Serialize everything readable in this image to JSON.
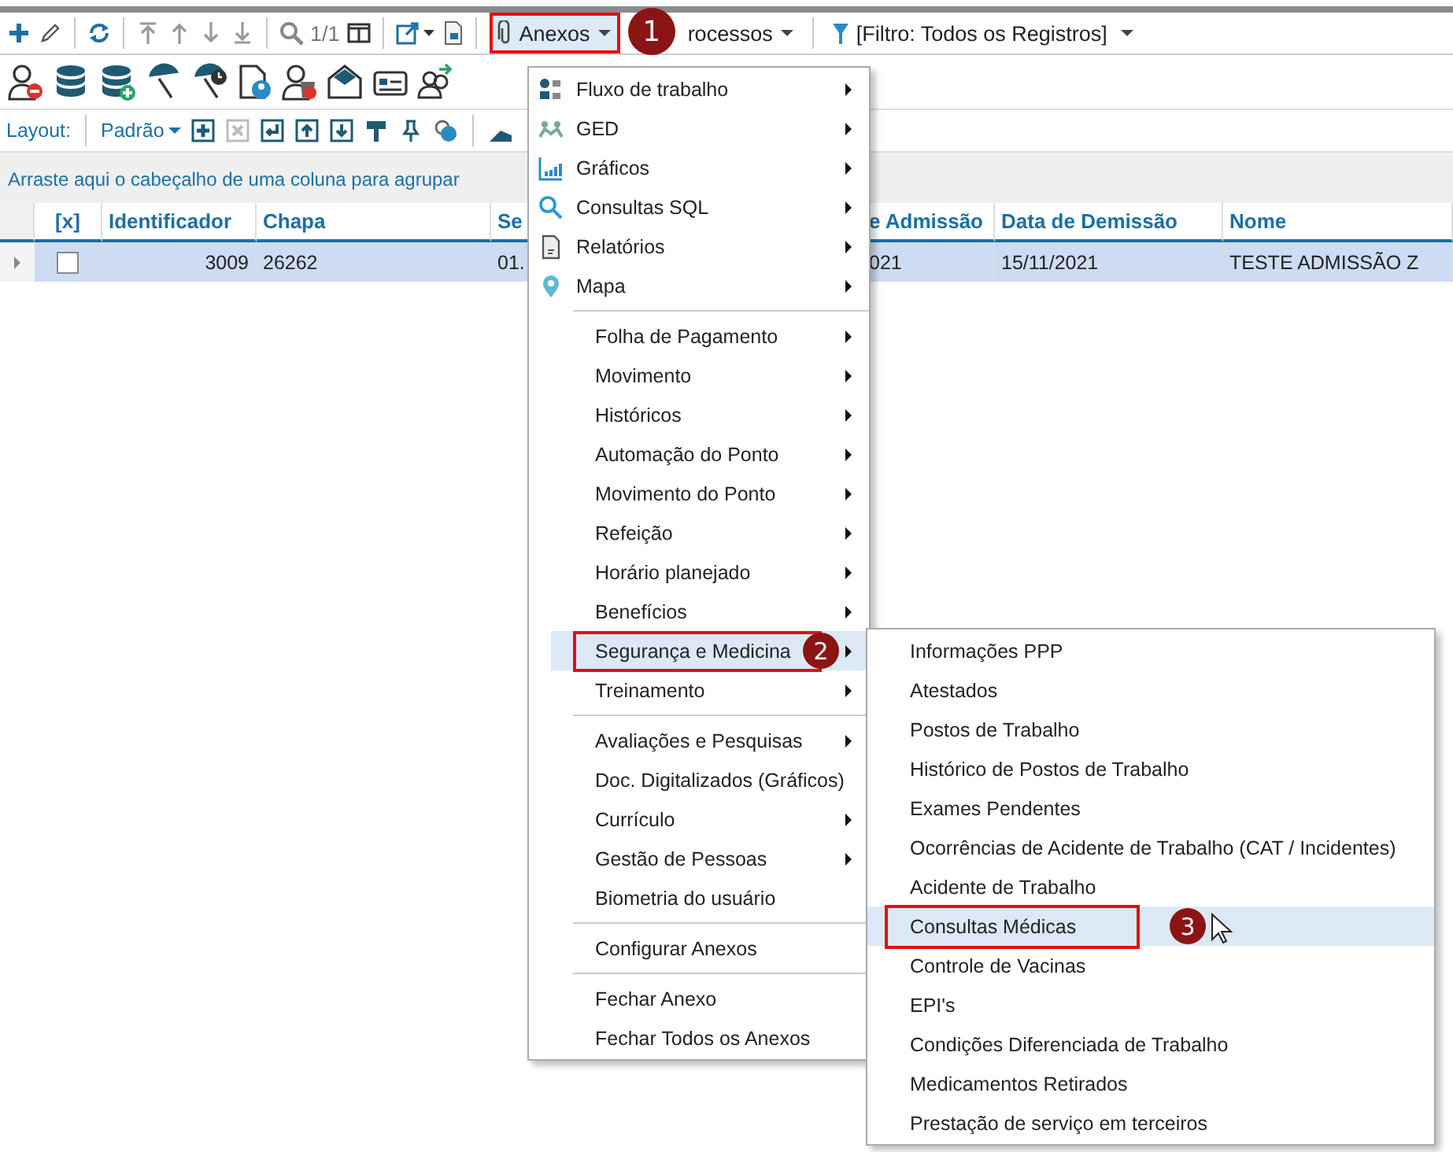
{
  "toolbar": {
    "page_counter": "1/1",
    "anexos": {
      "label": "Anexos",
      "annotated": true,
      "callout": "1"
    },
    "processos": {
      "label": "rocessos"
    },
    "filter": {
      "label": "[Filtro: Todos os Registros]"
    }
  },
  "layout_bar": {
    "label": "Layout:",
    "value": "Padrão"
  },
  "group_panel": {
    "hint": "Arraste aqui o cabeçalho de uma coluna para agrupar"
  },
  "table": {
    "checkbox_column": "[x]",
    "columns": [
      "Identificador",
      "Chapa",
      "Se",
      "e Admissão",
      "Data de Demissão",
      "Nome"
    ],
    "rows": [
      {
        "selected": true,
        "checked": false,
        "cells": [
          "3009",
          "26262",
          "01.",
          "021",
          "15/11/2021",
          "TESTE ADMISSÃO Z"
        ]
      }
    ]
  },
  "menu": {
    "groups": [
      [
        {
          "label": "Fluxo de trabalho",
          "submenu": true,
          "selected": false
        },
        {
          "label": "GED",
          "submenu": true,
          "selected": false
        },
        {
          "label": "Gráficos",
          "submenu": true,
          "selected": false
        },
        {
          "label": "Consultas SQL",
          "submenu": true,
          "selected": false
        },
        {
          "label": "Relatórios",
          "submenu": true,
          "selected": false
        },
        {
          "label": "Mapa",
          "submenu": true,
          "selected": false
        }
      ],
      [
        {
          "label": "Folha de Pagamento",
          "submenu": true,
          "selected": false
        },
        {
          "label": "Movimento",
          "submenu": true,
          "selected": false
        },
        {
          "label": "Históricos",
          "submenu": true,
          "selected": false
        },
        {
          "label": "Automação do Ponto",
          "submenu": true,
          "selected": false
        },
        {
          "label": "Movimento do Ponto",
          "submenu": true,
          "selected": false
        },
        {
          "label": "Refeição",
          "submenu": true,
          "selected": false
        },
        {
          "label": "Horário planejado",
          "submenu": true,
          "selected": false
        },
        {
          "label": "Benefícios",
          "submenu": true,
          "selected": false
        },
        {
          "label": "Segurança e Medicina",
          "submenu": true,
          "selected": true,
          "annotated": true,
          "callout": "2"
        },
        {
          "label": "Treinamento",
          "submenu": true,
          "selected": false
        }
      ],
      [
        {
          "label": "Avaliações e Pesquisas",
          "submenu": true,
          "selected": false
        },
        {
          "label": "Doc. Digitalizados (Gráficos)",
          "submenu": false,
          "selected": false
        },
        {
          "label": "Currículo",
          "submenu": true,
          "selected": false
        },
        {
          "label": "Gestão de Pessoas",
          "submenu": true,
          "selected": false
        },
        {
          "label": "Biometria do usuário",
          "submenu": false,
          "selected": false
        }
      ],
      [
        {
          "label": "Configurar Anexos",
          "submenu": false,
          "selected": false
        }
      ],
      [
        {
          "label": "Fechar Anexo",
          "submenu": false,
          "selected": false
        },
        {
          "label": "Fechar Todos os Anexos",
          "submenu": false,
          "selected": false
        }
      ]
    ]
  },
  "submenu": {
    "items": [
      {
        "label": "Informações PPP",
        "selected": false
      },
      {
        "label": "Atestados",
        "selected": false
      },
      {
        "label": "Postos de Trabalho",
        "selected": false
      },
      {
        "label": "Histórico de Postos de Trabalho",
        "selected": false
      },
      {
        "label": "Exames Pendentes",
        "selected": false
      },
      {
        "label": "Ocorrências de Acidente de Trabalho (CAT / Incidentes)",
        "selected": false
      },
      {
        "label": "Acidente de Trabalho",
        "selected": false
      },
      {
        "label": "Consultas Médicas",
        "selected": true,
        "annotated": true,
        "callout": "3"
      },
      {
        "label": "Controle de Vacinas",
        "selected": false
      },
      {
        "label": "EPI's",
        "selected": false
      },
      {
        "label": "Condições Diferenciada de Trabalho",
        "selected": false
      },
      {
        "label": "Medicamentos Retirados",
        "selected": false
      },
      {
        "label": "Prestação de serviço em terceiros",
        "selected": false
      }
    ]
  }
}
